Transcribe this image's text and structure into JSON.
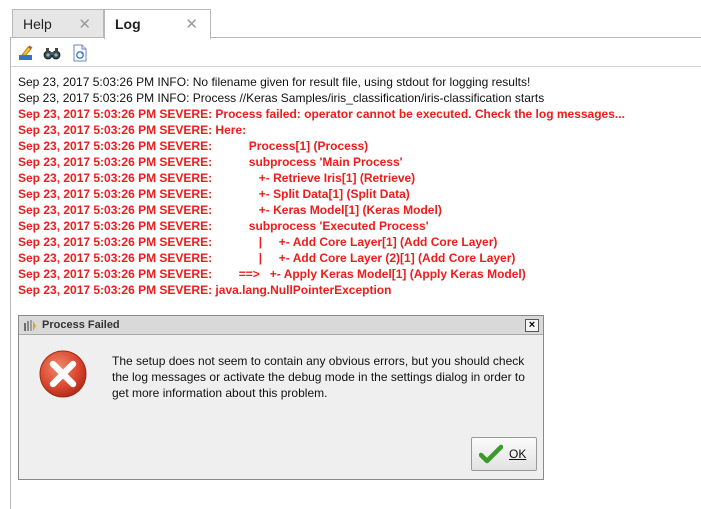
{
  "tabs": [
    {
      "label": "Help"
    },
    {
      "label": "Log"
    }
  ],
  "toolbar": {
    "icons": [
      "clear-log-icon",
      "find-icon",
      "save-log-icon"
    ]
  },
  "log": {
    "lines": [
      {
        "level": "info",
        "text": "Sep 23, 2017 5:03:26 PM INFO: No filename given for result file, using stdout for logging results!"
      },
      {
        "level": "info",
        "text": "Sep 23, 2017 5:03:26 PM INFO: Process //Keras Samples/iris_classification/iris-classification starts"
      },
      {
        "level": "severe",
        "text": "Sep 23, 2017 5:03:26 PM SEVERE: Process failed: operator cannot be executed. Check the log messages..."
      },
      {
        "level": "severe",
        "text": "Sep 23, 2017 5:03:26 PM SEVERE: Here:"
      },
      {
        "level": "severe",
        "text": "Sep 23, 2017 5:03:26 PM SEVERE:           Process[1] (Process)"
      },
      {
        "level": "severe",
        "text": "Sep 23, 2017 5:03:26 PM SEVERE:           subprocess 'Main Process'"
      },
      {
        "level": "severe",
        "text": "Sep 23, 2017 5:03:26 PM SEVERE:              +- Retrieve Iris[1] (Retrieve)"
      },
      {
        "level": "severe",
        "text": "Sep 23, 2017 5:03:26 PM SEVERE:              +- Split Data[1] (Split Data)"
      },
      {
        "level": "severe",
        "text": "Sep 23, 2017 5:03:26 PM SEVERE:              +- Keras Model[1] (Keras Model)"
      },
      {
        "level": "severe",
        "text": "Sep 23, 2017 5:03:26 PM SEVERE:           subprocess 'Executed Process'"
      },
      {
        "level": "severe",
        "text": "Sep 23, 2017 5:03:26 PM SEVERE:              |     +- Add Core Layer[1] (Add Core Layer)"
      },
      {
        "level": "severe",
        "text": "Sep 23, 2017 5:03:26 PM SEVERE:              |     +- Add Core Layer (2)[1] (Add Core Layer)"
      },
      {
        "level": "severe",
        "text": "Sep 23, 2017 5:03:26 PM SEVERE:        ==>   +- Apply Keras Model[1] (Apply Keras Model)"
      },
      {
        "level": "severe",
        "text": "Sep 23, 2017 5:03:26 PM SEVERE: java.lang.NullPointerException"
      }
    ]
  },
  "dialog": {
    "title": "Process Failed",
    "close_label": "×",
    "message": "The setup does not seem to contain any obvious errors, but you should check the log messages or activate the debug mode in the settings dialog in order to get more information about this problem.",
    "ok_label": "OK",
    "icons": [
      "process-failed-title-icon",
      "error-icon",
      "checkmark-icon"
    ]
  },
  "colors": {
    "severe": "#ee1c1c",
    "info": "#111111",
    "error_icon": "#d9452e",
    "ok_check": "#3a9a2a"
  }
}
